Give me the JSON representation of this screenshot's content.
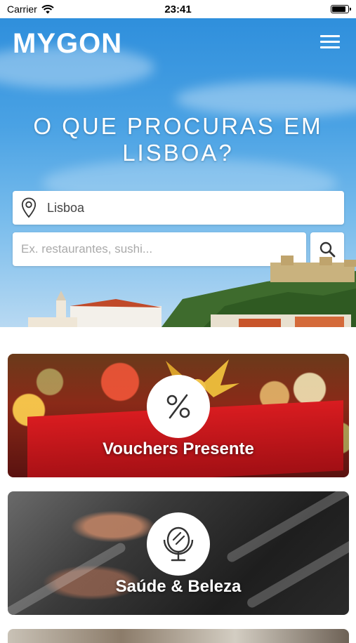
{
  "status_bar": {
    "carrier": "Carrier",
    "time": "23:41"
  },
  "header": {
    "logo": "MYGON",
    "menu_icon": "hamburger-menu-icon"
  },
  "hero": {
    "title": "O QUE PROCURAS EM LISBOA?",
    "location": {
      "icon": "map-pin-icon",
      "value": "Lisboa"
    },
    "search": {
      "placeholder": "Ex. restaurantes, sushi...",
      "value": "",
      "icon": "search-icon"
    }
  },
  "categories": [
    {
      "label": "Vouchers Presente",
      "icon": "percent-icon"
    },
    {
      "label": "Saúde & Beleza",
      "icon": "mirror-icon"
    }
  ],
  "colors": {
    "sky": "#3a96de",
    "white": "#ffffff"
  }
}
